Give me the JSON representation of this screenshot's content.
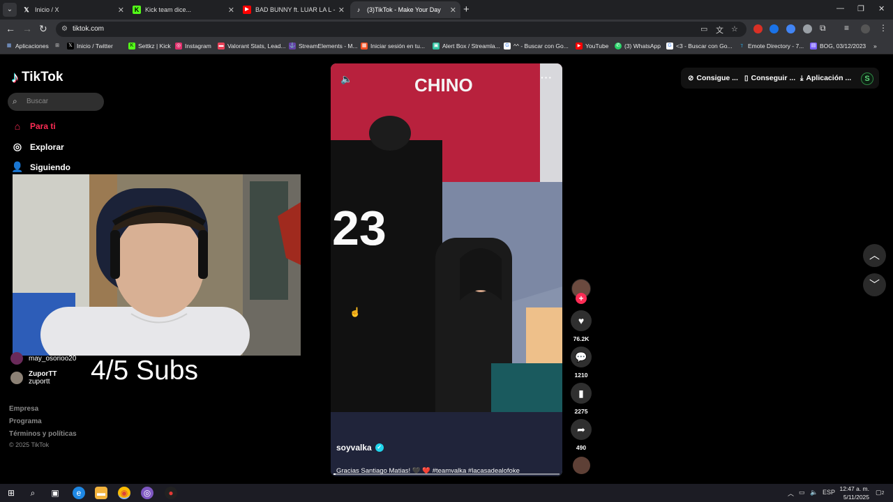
{
  "browser": {
    "tabs": [
      {
        "label": "Inicio / X",
        "icon": "x-logo-icon",
        "active": false
      },
      {
        "label": "Kick team dice...",
        "icon": "kick-logo-icon",
        "active": false
      },
      {
        "label": "BAD BUNNY ft. LUAR LA L - TE",
        "icon": "youtube-icon",
        "active": false
      },
      {
        "label": "(3)TikTok - Make Your Day",
        "icon": "tiktok-icon",
        "active": true
      }
    ],
    "url": "tiktok.com",
    "bookmarks": [
      {
        "label": "Aplicaciones",
        "icon": "apps-grid-icon",
        "color": "#8ab4f8"
      },
      {
        "label": "",
        "icon": "tab-groups-icon",
        "color": "#cccccc"
      },
      {
        "label": "Inicio / Twitter",
        "icon": "x-logo-icon",
        "color": "#000000"
      },
      {
        "label": "Settkz | Kick",
        "icon": "kick-logo-icon",
        "color": "#53fc18"
      },
      {
        "label": "Instagram",
        "icon": "instagram-icon",
        "color": "#e1306c"
      },
      {
        "label": "Valorant Stats, Lead...",
        "icon": "tracker-icon",
        "color": "#e84057"
      },
      {
        "label": "StreamElements - M...",
        "icon": "streamelements-icon",
        "color": "#6441a5"
      },
      {
        "label": "Iniciar sesión en tu...",
        "icon": "microsoft-icon",
        "color": "#f25022"
      },
      {
        "label": "Alert Box / Streamla...",
        "icon": "streamlabs-icon",
        "color": "#31c3a2"
      },
      {
        "label": "^^ - Buscar con Go...",
        "icon": "google-icon",
        "color": "#ffffff"
      },
      {
        "label": "YouTube",
        "icon": "youtube-icon",
        "color": "#ff0000"
      },
      {
        "label": "(3) WhatsApp",
        "icon": "whatsapp-icon",
        "color": "#25d366"
      },
      {
        "label": "<3 - Buscar con Go...",
        "icon": "google-icon",
        "color": "#ffffff"
      },
      {
        "label": "Emote Directory - 7...",
        "icon": "7tv-icon",
        "color": "#29b6f6"
      },
      {
        "label": "BOG, 03/12/2023",
        "icon": "document-icon",
        "color": "#7b61ff"
      }
    ]
  },
  "tiktok": {
    "logo": "TikTok",
    "search_placeholder": "Buscar",
    "nav": [
      {
        "label": "Para ti",
        "icon": "home-icon"
      },
      {
        "label": "Explorar",
        "icon": "compass-icon"
      },
      {
        "label": "Siguiendo",
        "icon": "following-icon"
      }
    ],
    "following_accounts": [
      {
        "name": "may_osorioo20",
        "handle": ""
      },
      {
        "name": "ZuporTT",
        "handle": "zuportt"
      }
    ],
    "footer_links": [
      "Empresa",
      "Programa",
      "Términos y políticas"
    ],
    "copyright": "© 2025 TikTok",
    "overlay_text": "4/5 Subs",
    "top_buttons": [
      {
        "label": "Consigue ...",
        "icon": "coin-icon"
      },
      {
        "label": "Conseguir ...",
        "icon": "phone-icon"
      },
      {
        "label": "Aplicación ...",
        "icon": "download-icon"
      }
    ],
    "profile_initial": "S",
    "video": {
      "author": "soyvalka",
      "caption": "Gracias Santiago Matias! 🖤 ❤️ #teamvalka #lacasadealofoke",
      "progress": 0.01
    },
    "actions": {
      "likes": "76.2K",
      "comments": "1210",
      "saves": "2275",
      "shares": "490"
    }
  },
  "taskbar": {
    "language": "ESP",
    "time": "12:47 a. m.",
    "date": "5/11/2025",
    "notification_count": "2"
  }
}
